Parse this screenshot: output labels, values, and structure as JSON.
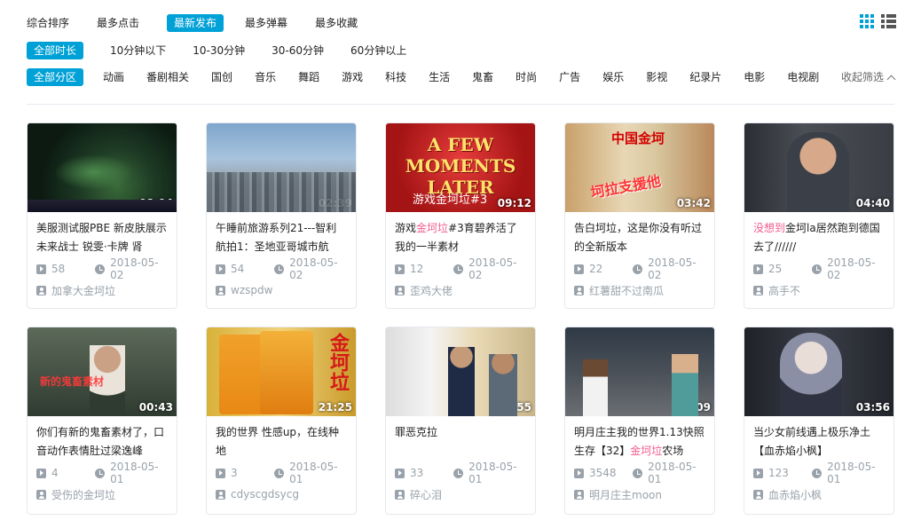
{
  "sort_tabs": [
    "综合排序",
    "最多点击",
    "最新发布",
    "最多弹幕",
    "最多收藏"
  ],
  "duration_filters": [
    "全部时长",
    "10分钟以下",
    "10-30分钟",
    "30-60分钟",
    "60分钟以上"
  ],
  "zone_filters": [
    "全部分区",
    "动画",
    "番剧相关",
    "国创",
    "音乐",
    "舞蹈",
    "游戏",
    "科技",
    "生活",
    "鬼畜",
    "时尚",
    "广告",
    "娱乐",
    "影视",
    "纪录片",
    "电影",
    "电视剧"
  ],
  "collapse_label": "收起筛选",
  "colors": {
    "accent": "#00a1d6",
    "highlight": "#f25d8e",
    "meta": "#99a2aa"
  },
  "icons": {
    "grid_view": "grid-view-icon",
    "list_view": "list-view-icon",
    "play": "play-count-icon",
    "clock": "clock-icon",
    "user": "uploader-icon"
  },
  "videos": [
    {
      "thumb_text": "",
      "duration": "08:04",
      "title": [
        {
          "t": "美服测试服PBE 新皮肤展示 未来战士 锐雯·卡牌 肾"
        }
      ],
      "plays": "58",
      "date": "2018-05-02",
      "uploader": "加拿大金坷垃"
    },
    {
      "thumb_text": "",
      "duration": "02:39",
      "title": [
        {
          "t": "午睡前旅游系列21---智利航拍1：圣地亚哥城市航拍！"
        }
      ],
      "plays": "54",
      "date": "2018-05-02",
      "uploader": "wzspdw"
    },
    {
      "thumb_text": "A FEW MOMENTS LATER",
      "thumb_sub": "游戏金坷垃#3",
      "duration": "09:12",
      "title": [
        {
          "t": "游戏"
        },
        {
          "t": "金坷垃",
          "hl": true
        },
        {
          "t": "#3育碧养活了我的一半素材"
        }
      ],
      "plays": "12",
      "date": "2018-05-02",
      "uploader": "歪鸡大佬"
    },
    {
      "thumb_text": "中国金坷",
      "thumb_sub": "坷拉支援他",
      "duration": "03:42",
      "title": [
        {
          "t": "告白坷垃，这是你没有听过的全新版本"
        }
      ],
      "plays": "22",
      "date": "2018-05-02",
      "uploader": "红薯甜不过南瓜"
    },
    {
      "thumb_text": "",
      "thumb_sub": "",
      "duration": "04:40",
      "title": [
        {
          "t": "没想到",
          "hl": true
        },
        {
          "t": "金坷la居然跑到德国去了//////"
        }
      ],
      "plays": "25",
      "date": "2018-05-02",
      "uploader": "高手不"
    },
    {
      "thumb_text": "",
      "thumb_sub": "新的鬼畜素材",
      "duration": "00:43",
      "title": [
        {
          "t": "你们有新的鬼畜素材了，口音动作表情肚过梁逸峰"
        }
      ],
      "plays": "4",
      "date": "2018-05-01",
      "uploader": "受伤的金坷垃"
    },
    {
      "thumb_text": "金坷垃",
      "thumb_sub": "",
      "duration": "21:25",
      "title": [
        {
          "t": "我的世界 性感up，在线种地"
        }
      ],
      "plays": "3",
      "date": "2018-05-01",
      "uploader": "cdyscgdsycg"
    },
    {
      "thumb_text": "",
      "thumb_sub": "",
      "duration": "00:55",
      "title": [
        {
          "t": "罪恶克拉"
        }
      ],
      "plays": "33",
      "date": "2018-05-01",
      "uploader": "碎心泪"
    },
    {
      "thumb_text": "",
      "thumb_sub": "",
      "duration": "10:09",
      "title": [
        {
          "t": "明月庄主我的世界1.13快照生存【32】"
        },
        {
          "t": "金坷垃",
          "hl": true
        },
        {
          "t": "农场"
        }
      ],
      "plays": "3548",
      "date": "2018-05-01",
      "uploader": "明月庄主moon"
    },
    {
      "thumb_text": "",
      "thumb_sub": "",
      "duration": "03:56",
      "title": [
        {
          "t": "当少女前线遇上极乐净土【血赤焰小枫】"
        }
      ],
      "plays": "123",
      "date": "2018-05-01",
      "uploader": "血赤焰小枫"
    }
  ]
}
